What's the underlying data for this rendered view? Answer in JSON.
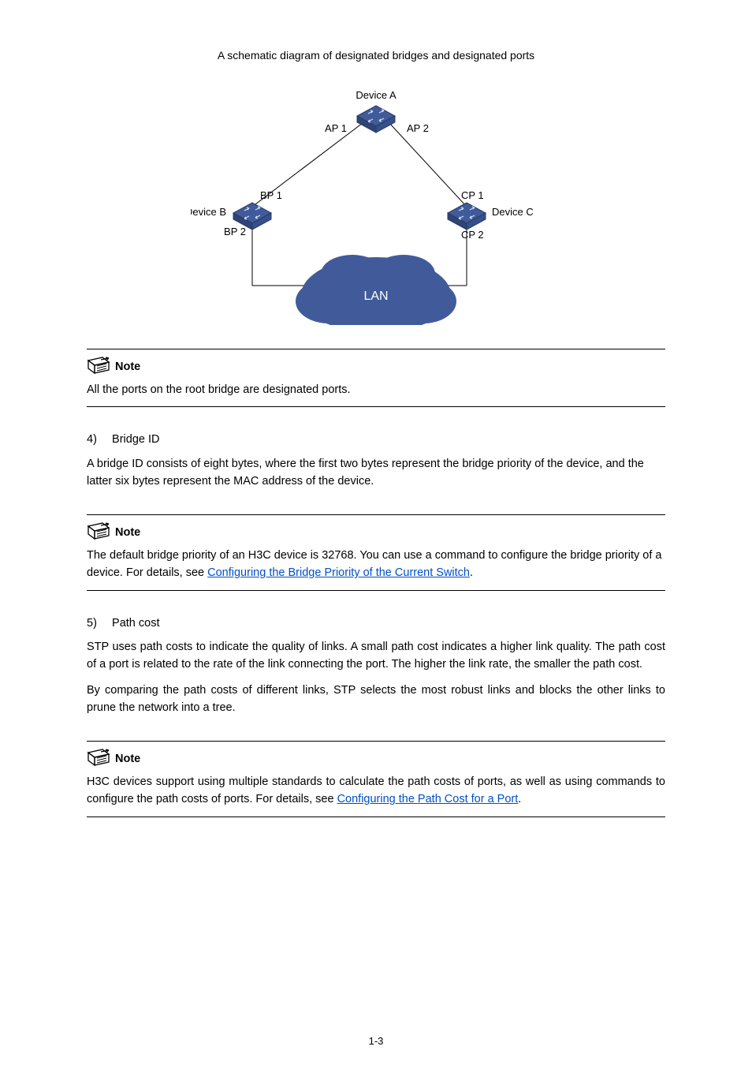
{
  "figure": {
    "caption": "A schematic diagram of designated bridges and designated ports",
    "labels": {
      "deviceA": "Device A",
      "deviceB": "Device B",
      "deviceC": "Device C",
      "ap1": "AP 1",
      "ap2": "AP 2",
      "bp1": "BP 1",
      "bp2": "BP 2",
      "cp1": "CP 1",
      "cp2": "CP 2",
      "lan": "LAN"
    }
  },
  "note1": {
    "label": "Note",
    "text": "All the ports on the root bridge are designated ports."
  },
  "section4": {
    "numbered": "4)",
    "title": "Bridge ID",
    "paragraph": "A bridge ID consists of eight bytes, where the first two bytes represent the bridge priority of the device, and the latter six bytes represent the MAC address of the device."
  },
  "note2": {
    "label": "Note",
    "text_prefix": "The default bridge priority of an H3C device is 32768. You can use a command to configure the bridge priority of a device. For details, see ",
    "link_text": "Configuring the Bridge Priority of the Current Switch",
    "text_suffix": "."
  },
  "section5": {
    "numbered": "5)",
    "title": "Path cost",
    "paragraph1": "STP uses path costs to indicate the quality of links. A small path cost indicates a higher link quality. The path cost of a port is related to the rate of the link connecting the port. The higher the link rate, the smaller the path cost.",
    "paragraph2": "By comparing the path costs of different links, STP selects the most robust links and blocks the other links to prune the network into a tree."
  },
  "note3": {
    "label": "Note",
    "text_prefix": "H3C devices support using multiple standards to calculate the path costs of ports, as well as using commands to configure the path costs of ports. For details, see ",
    "link_text": "Configuring the Path Cost for a Port",
    "text_suffix": "."
  },
  "page_number": "1-3"
}
